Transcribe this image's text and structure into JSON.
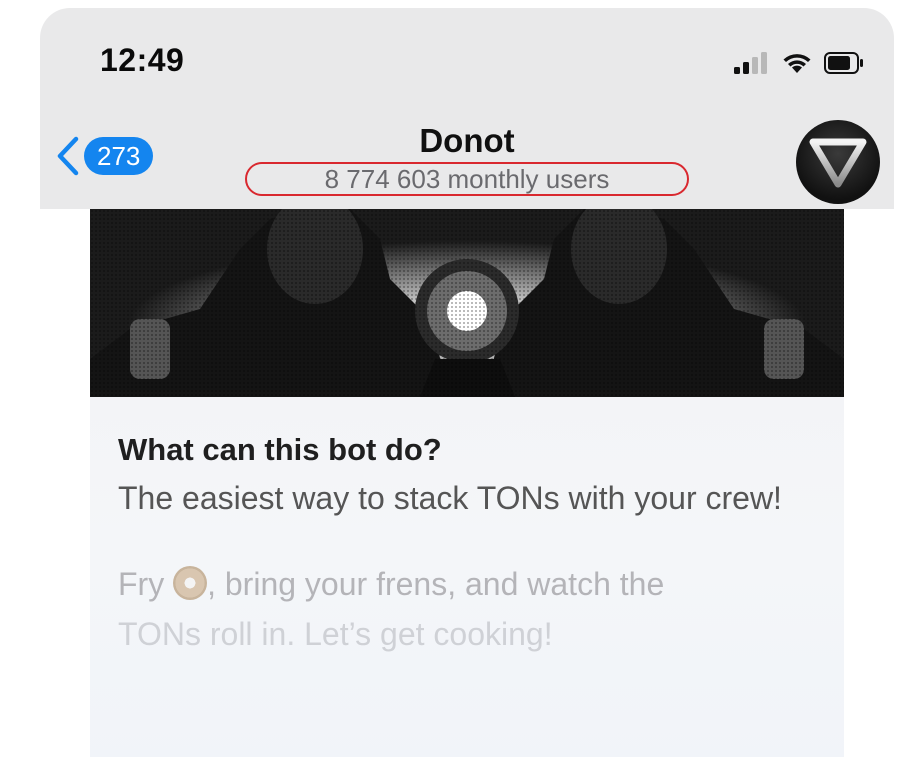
{
  "status_bar": {
    "time": "12:49",
    "icons": [
      "signal-icon",
      "wifi-icon",
      "battery-icon"
    ]
  },
  "header": {
    "back_count": "273",
    "title": "Donot",
    "subtitle": "8 774 603 monthly users",
    "highlight_color": "#d9282f",
    "badge_color": "#1485ef",
    "avatar_icon": "triangle-logo-icon"
  },
  "bot_info": {
    "heading": "What can this bot do?",
    "description": "The easiest way to stack TONs with your crew!",
    "line2_prefix": "Fry ",
    "line2_suffix": ", bring your frens, and watch the",
    "line3": "TONs roll in. Let’s get cooking!",
    "emoji": "donut-icon"
  }
}
